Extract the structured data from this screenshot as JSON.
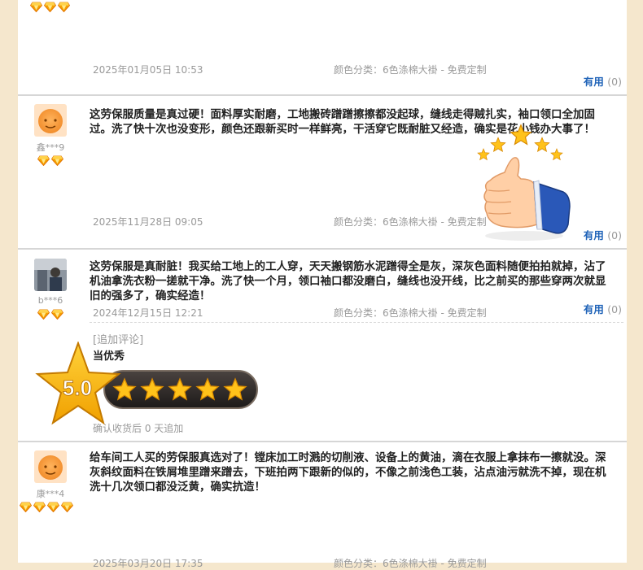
{
  "reviews": [
    {
      "date": "2025年01月05日  10:53",
      "spec": "颜色分类：6色涤棉大褂 - 免费定制",
      "useful_label": "有用",
      "useful_count": "(0)"
    },
    {
      "nickname": "鑫***9",
      "text": "这劳保服质量是真过硬！面料厚实耐磨，工地搬砖蹭蹭擦擦都没起球，缝线走得贼扎实，袖口领口全加固过。洗了快十次也没变形，颜色还跟新买时一样鲜亮，干活穿它既耐脏又经造，确实是花小钱办大事了！",
      "date": "2025年11月28日  09:05",
      "spec": "颜色分类：6色涤棉大褂 - 免费定制",
      "useful_label": "有用",
      "useful_count": "(0)"
    },
    {
      "nickname": "b***6",
      "text": "这劳保服是真耐脏！我买给工地上的工人穿，天天搬钢筋水泥蹭得全是灰，深灰色面料随便拍拍就掉，沾了机油拿洗衣粉一搓就干净。洗了快一个月，领口袖口都没磨白，缝线也没开线，比之前买的那些穿两次就显旧的强多了，确实经造！",
      "date": "2024年12月15日  12:21",
      "spec": "颜色分类：6色涤棉大褂 - 免费定制",
      "useful_label": "有用",
      "useful_count": "(0)",
      "followup_label": "[追加评论]",
      "followup_text": "当优秀",
      "followup_meta": "确认收货后 0 天追加"
    },
    {
      "nickname": "康***4",
      "text": "给车间工人买的劳保服真选对了！镗床加工时溅的切削液、设备上的黄油，滴在衣服上拿抹布一擦就没。深灰斜纹面料在铁屑堆里蹭来蹭去，下班拍两下跟新的似的，不像之前浅色工装，沾点油污就洗不掉，现在机洗十几次领口都没泛黄，确实抗造！",
      "date": "2025年03月20日  17:35",
      "spec": "颜色分类：6色涤棉大褂 - 免费定制"
    }
  ],
  "rating_badge": {
    "score": "5.0",
    "stars": 5
  },
  "colors": {
    "link": "#1f63b8",
    "gem": "#f5a000",
    "background": "#f5e7cd"
  },
  "icons": [
    "gem-icon",
    "thumbs-up-icon",
    "star-icon",
    "avatar-icon"
  ]
}
